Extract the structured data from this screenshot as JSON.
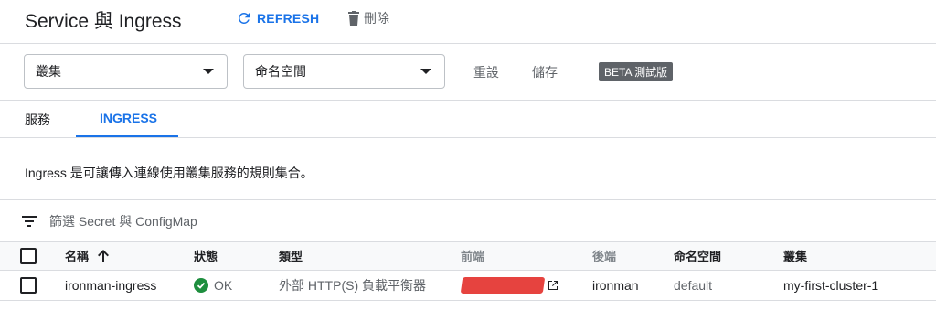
{
  "header": {
    "title": "Service 與 Ingress",
    "refresh_label": "REFRESH",
    "delete_label": "刪除"
  },
  "filters": {
    "cluster_placeholder": "叢集",
    "namespace_placeholder": "命名空間",
    "reset_label": "重設",
    "save_label": "儲存",
    "beta_badge": "BETA 測試版"
  },
  "tabs": [
    {
      "label": "服務",
      "active": false
    },
    {
      "label": "INGRESS",
      "active": true
    }
  ],
  "description": "Ingress 是可讓傳入連線使用叢集服務的規則集合。",
  "table_filter": {
    "icon": "filter-list-icon",
    "label": "篩選 Secret 與 ConfigMap"
  },
  "table": {
    "columns": {
      "name": "名稱",
      "status": "狀態",
      "type": "類型",
      "frontend": "前端",
      "backend": "後端",
      "namespace": "命名空間",
      "cluster": "叢集"
    },
    "sort_icon": "arrow-up-icon",
    "rows": [
      {
        "name": "ironman-ingress",
        "status": "OK",
        "type": "外部 HTTP(S) 負載平衡器",
        "frontend": "(redacted)",
        "backend": "ironman",
        "namespace": "default",
        "cluster": "my-first-cluster-1"
      }
    ]
  },
  "colors": {
    "accent": "#1a73e8",
    "ok": "#1e8e3e",
    "badge_bg": "#5f6368",
    "redaction": "#e53935"
  }
}
